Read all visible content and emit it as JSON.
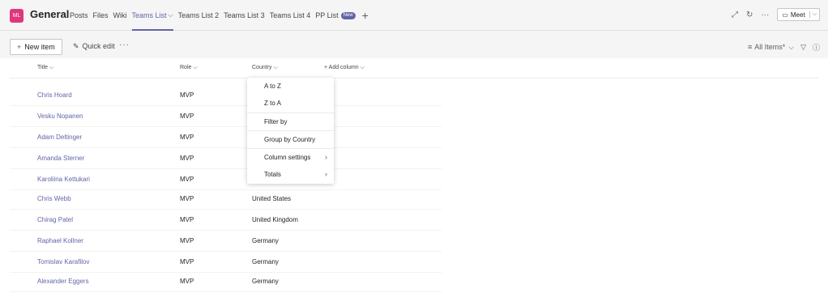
{
  "header": {
    "avatar_initials": "ML",
    "avatar_color": "#e0367f",
    "team_name": "General",
    "tabs": [
      {
        "label": "Posts"
      },
      {
        "label": "Files"
      },
      {
        "label": "Wiki"
      },
      {
        "label": "Teams List",
        "active": true
      },
      {
        "label": "Teams List 2"
      },
      {
        "label": "Teams List 3"
      },
      {
        "label": "Teams List 4"
      },
      {
        "label": "PP List",
        "badge": "New"
      }
    ],
    "add_tab": "+",
    "meet_label": "Meet",
    "accent_color": "#6264a7"
  },
  "commandbar": {
    "new_item_label": "New item",
    "quick_edit_label": "Quick edit",
    "more_label": "···",
    "view_label": "All Items*"
  },
  "columns": {
    "title": "Title",
    "role": "Role",
    "country": "Country",
    "add": "+ Add column"
  },
  "rows": [
    {
      "title": "Chris Hoard",
      "role": "MVP",
      "country": ""
    },
    {
      "title": "Vesku Nopanen",
      "role": "MVP",
      "country": ""
    },
    {
      "title": "Adam Deltinger",
      "role": "MVP",
      "country": ""
    },
    {
      "title": "Amanda Sterner",
      "role": "MVP",
      "country": ""
    },
    {
      "title": "Karoliina Kettukari",
      "role": "MVP",
      "country": ""
    },
    {
      "title": "Chris Webb",
      "role": "MVP",
      "country": "United States"
    },
    {
      "title": "Chirag Patel",
      "role": "MVP",
      "country": "United Kingdom"
    },
    {
      "title": "Raphael Kollner",
      "role": "MVP",
      "country": "Germany"
    },
    {
      "title": "Tomislav Karafilov",
      "role": "MVP",
      "country": "Germany"
    },
    {
      "title": "Alexander Eggers",
      "role": "MVP",
      "country": "Germany"
    }
  ],
  "dropdown": {
    "a_to_z": "A to Z",
    "z_to_a": "Z to A",
    "filter_by": "Filter by",
    "group_by": "Group by Country",
    "column_settings": "Column settings",
    "totals": "Totals"
  }
}
